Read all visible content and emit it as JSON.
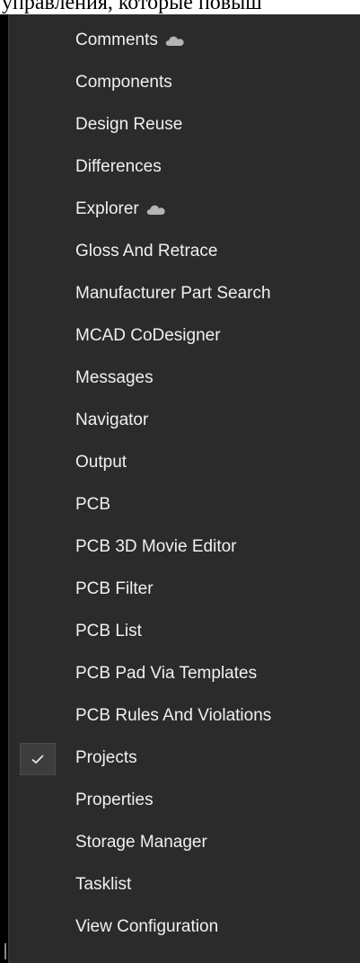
{
  "background_text": "управления, которые повыш",
  "menu": {
    "items": [
      {
        "label": "Comments",
        "cloud": true,
        "checked": false
      },
      {
        "label": "Components",
        "cloud": false,
        "checked": false
      },
      {
        "label": "Design Reuse",
        "cloud": false,
        "checked": false
      },
      {
        "label": "Differences",
        "cloud": false,
        "checked": false
      },
      {
        "label": "Explorer",
        "cloud": true,
        "checked": false
      },
      {
        "label": "Gloss And Retrace",
        "cloud": false,
        "checked": false
      },
      {
        "label": "Manufacturer Part Search",
        "cloud": false,
        "checked": false
      },
      {
        "label": "MCAD CoDesigner",
        "cloud": false,
        "checked": false
      },
      {
        "label": "Messages",
        "cloud": false,
        "checked": false
      },
      {
        "label": "Navigator",
        "cloud": false,
        "checked": false
      },
      {
        "label": "Output",
        "cloud": false,
        "checked": false
      },
      {
        "label": "PCB",
        "cloud": false,
        "checked": false
      },
      {
        "label": "PCB 3D Movie Editor",
        "cloud": false,
        "checked": false
      },
      {
        "label": "PCB Filter",
        "cloud": false,
        "checked": false
      },
      {
        "label": "PCB List",
        "cloud": false,
        "checked": false
      },
      {
        "label": "PCB Pad Via Templates",
        "cloud": false,
        "checked": false
      },
      {
        "label": "PCB Rules And Violations",
        "cloud": false,
        "checked": false
      },
      {
        "label": "Projects",
        "cloud": false,
        "checked": true
      },
      {
        "label": "Properties",
        "cloud": false,
        "checked": false
      },
      {
        "label": "Storage Manager",
        "cloud": false,
        "checked": false
      },
      {
        "label": "Tasklist",
        "cloud": false,
        "checked": false
      },
      {
        "label": "View Configuration",
        "cloud": false,
        "checked": false
      }
    ]
  },
  "colors": {
    "menu_bg": "#2b2b2b",
    "text": "#f0f0f0",
    "cloud": "#b4b4b4",
    "check": "#e6e6e6"
  }
}
